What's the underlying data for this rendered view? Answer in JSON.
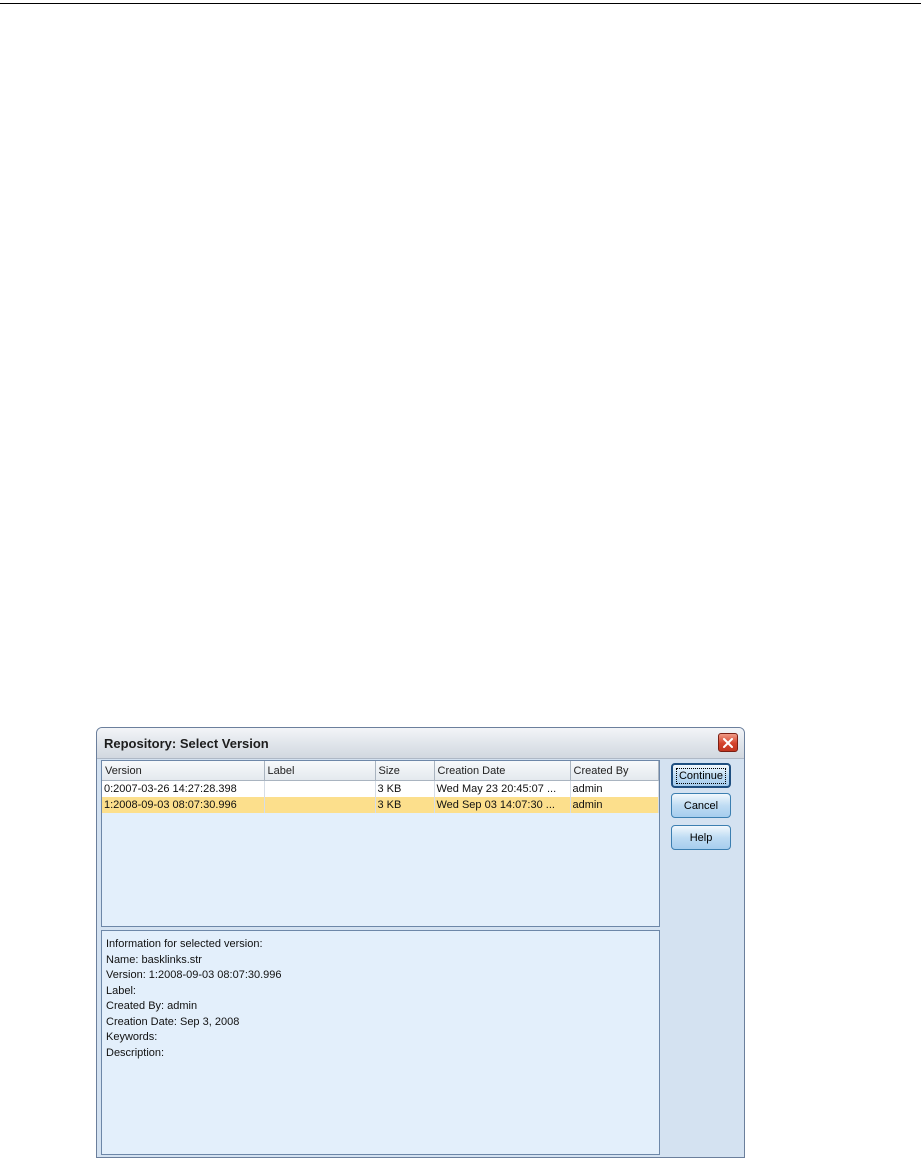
{
  "dialog": {
    "title": "Repository: Select Version",
    "close_icon": "close-icon"
  },
  "table": {
    "columns": [
      "Version",
      "Label",
      "Size",
      "Creation Date",
      "Created By"
    ],
    "rows": [
      {
        "version": "0:2007-03-26 14:27:28.398",
        "label": "",
        "size": "3 KB",
        "creation_date": "Wed May 23 20:45:07 ...",
        "created_by": "admin"
      },
      {
        "version": "1:2008-09-03 08:07:30.996",
        "label": "",
        "size": "3 KB",
        "creation_date": "Wed Sep 03 14:07:30 ...",
        "created_by": "admin"
      }
    ],
    "selected_index": 1
  },
  "info": {
    "heading": "Information for selected version:",
    "name": "Name: basklinks.str",
    "version": "Version: 1:2008-09-03 08:07:30.996",
    "label": "Label:",
    "created_by": "Created By: admin",
    "creation_date": "Creation Date: Sep 3, 2008",
    "keywords": "Keywords:",
    "description": "Description:"
  },
  "buttons": {
    "continue": "Continue",
    "cancel": "Cancel",
    "help": "Help"
  },
  "colors": {
    "selected_row": "#fcdf8c",
    "panel_bg": "#e3effb",
    "dialog_bg": "#d4e2f1",
    "close_button": "#d4432c"
  }
}
